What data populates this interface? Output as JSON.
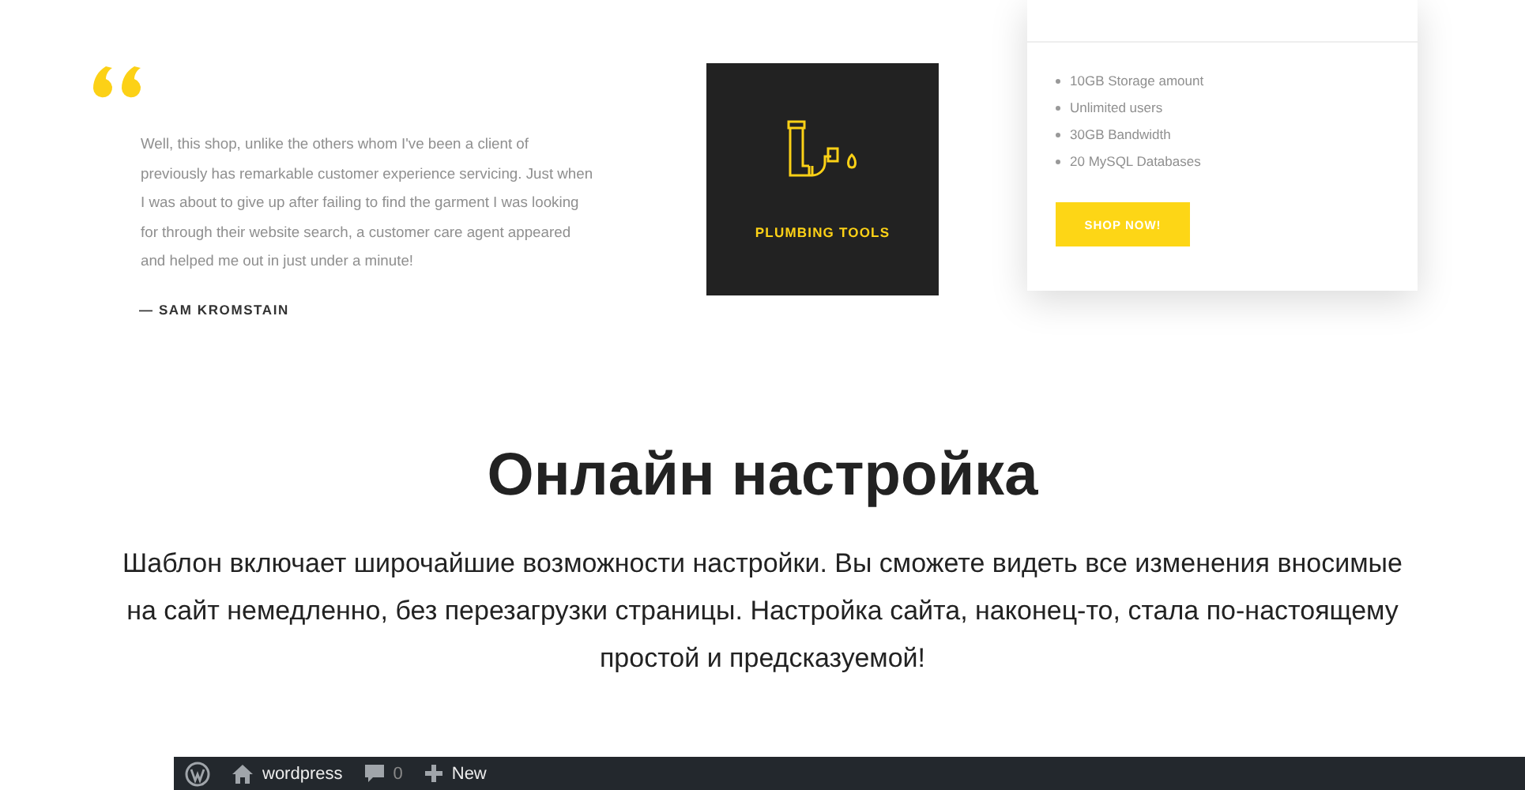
{
  "testimonial": {
    "quote": "Well, this shop, unlike the others whom I've been a client of previously has remarkable customer experience servicing. Just when I was about to give up after failing to find the garment I was looking for through their website search, a customer care agent appeared and helped me out in just under a minute!",
    "author": "— SAM KROMSTAIN"
  },
  "category_tile": {
    "label": "PLUMBING TOOLS"
  },
  "pricing_card": {
    "features": [
      "10GB Storage amount",
      "Unlimited users",
      "30GB Bandwidth",
      "20 MySQL Databases"
    ],
    "button": "SHOP NOW!"
  },
  "section": {
    "title": "Онлайн настройка",
    "text": "Шаблон включает широчайшие возможности настройки. Вы сможете видеть все изменения вносимые на сайт немедленно, без перезагрузки страницы. Настройка сайта, наконец-то, стала по-настоящему простой и предсказуемой!"
  },
  "admin_bar": {
    "site": "wordpress",
    "comments": "0",
    "new": "New"
  }
}
